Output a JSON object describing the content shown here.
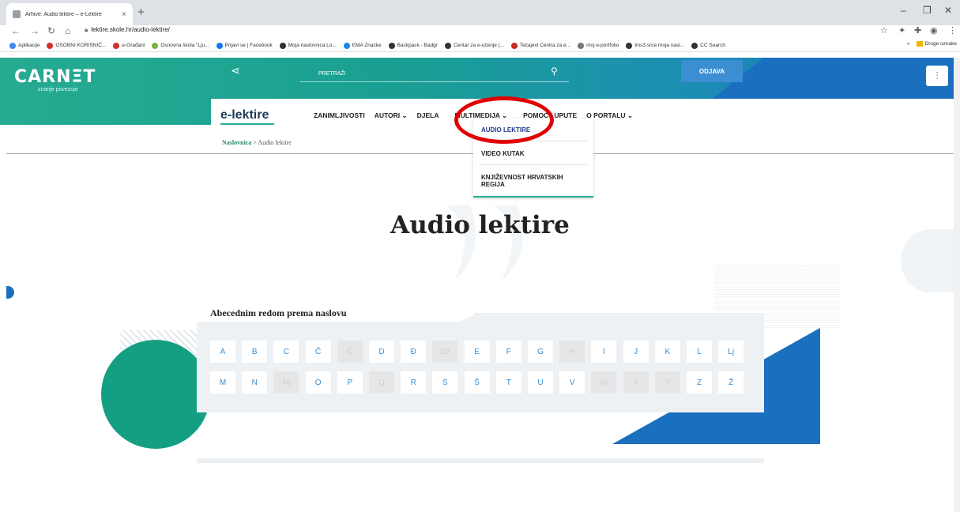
{
  "browser": {
    "tab_title": "Arhive: Audio lektire – e-Lektire",
    "tab_close": "×",
    "new_tab": "+",
    "url": "lektire.skole.hr/audio-lektire/",
    "bookmarks": [
      {
        "label": "Aplikacije",
        "color": "#4285f4"
      },
      {
        "label": "OSOBNI KORISNIČ...",
        "color": "#d32f2f"
      },
      {
        "label": "e-Građani",
        "color": "#d32f2f"
      },
      {
        "label": "Osnovna škola \"Lju...",
        "color": "#7cb342"
      },
      {
        "label": "Prijavi se | Facebook",
        "color": "#1877f2"
      },
      {
        "label": "Moja naslovnica Lo...",
        "color": "#333333"
      },
      {
        "label": "EMA Značke",
        "color": "#1e88e5"
      },
      {
        "label": "Backpack - Badgr",
        "color": "#333333"
      },
      {
        "label": "Centar za e-učenje |...",
        "color": "#333333"
      },
      {
        "label": "Tečajevi Centra za e...",
        "color": "#c62828"
      },
      {
        "label": "moj e-portfolio",
        "color": "#777777"
      },
      {
        "label": "lms3.srce moja nasl...",
        "color": "#333333"
      },
      {
        "label": "CC Search",
        "color": "#333333"
      }
    ],
    "bookmarks_overflow": "»",
    "other_bookmarks": "Druge oznake"
  },
  "header": {
    "logo": "CARNΞT",
    "logo_sub": "znanje povezuje",
    "search_placeholder": "PRETRAŽI",
    "logout": "ODJAVA"
  },
  "nav": {
    "brand": "e-lektire",
    "menu": [
      "ZANIMLJIVOSTI",
      "AUTORI ⌄",
      "DJELA",
      "MULTIMEDIJA ⌄",
      "POMOĆ I UPUTE",
      "O PORTALU ⌄"
    ],
    "dropdown": [
      "AUDIO LEKTIRE",
      "VIDEO KUTAK",
      "KNJIŽEVNOST HRVATSKIH REGIJA"
    ]
  },
  "breadcrumb": {
    "home": "Naslovnica",
    "sep": " > ",
    "current": "Audio lektire"
  },
  "page": {
    "title": "Audio lektire",
    "section_title": "Abecednim redom prema naslovu"
  },
  "letters": {
    "row1": [
      {
        "l": "A",
        "off": false
      },
      {
        "l": "B",
        "off": false
      },
      {
        "l": "C",
        "off": false
      },
      {
        "l": "Č",
        "off": false
      },
      {
        "l": "Ć",
        "off": true
      },
      {
        "l": "D",
        "off": false
      },
      {
        "l": "Đ",
        "off": false
      },
      {
        "l": "Dž",
        "off": true
      },
      {
        "l": "E",
        "off": false
      },
      {
        "l": "F",
        "off": false
      },
      {
        "l": "G",
        "off": false
      },
      {
        "l": "H",
        "off": true
      },
      {
        "l": "I",
        "off": false
      },
      {
        "l": "J",
        "off": false
      },
      {
        "l": "K",
        "off": false
      },
      {
        "l": "L",
        "off": false
      },
      {
        "l": "Lj",
        "off": false
      }
    ],
    "row2": [
      {
        "l": "M",
        "off": false
      },
      {
        "l": "N",
        "off": false
      },
      {
        "l": "Nj",
        "off": true
      },
      {
        "l": "O",
        "off": false
      },
      {
        "l": "P",
        "off": false
      },
      {
        "l": "Q",
        "off": true
      },
      {
        "l": "R",
        "off": false
      },
      {
        "l": "S",
        "off": false
      },
      {
        "l": "Š",
        "off": false
      },
      {
        "l": "T",
        "off": false
      },
      {
        "l": "U",
        "off": false
      },
      {
        "l": "V",
        "off": false
      },
      {
        "l": "W",
        "off": true
      },
      {
        "l": "X",
        "off": true
      },
      {
        "l": "Y",
        "off": true
      },
      {
        "l": "Z",
        "off": false
      },
      {
        "l": "Ž",
        "off": false
      }
    ]
  },
  "colors": {
    "accent_green": "#26ab91",
    "accent_blue": "#1a6fbf",
    "link_blue": "#3b8ed1",
    "highlight_red": "#e00000"
  }
}
